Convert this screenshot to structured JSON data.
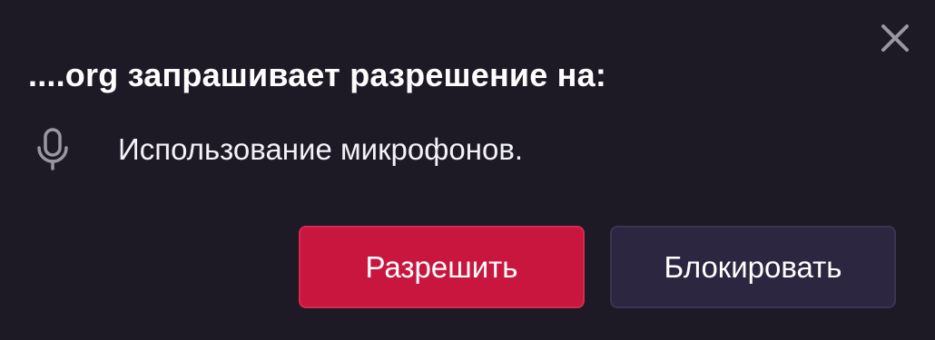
{
  "dialog": {
    "title": "....org запрашивает разрешение на:",
    "close_icon": "close-icon",
    "permission": {
      "icon": "microphone-icon",
      "text": "Использование микрофонов."
    },
    "buttons": {
      "allow_label": "Разрешить",
      "block_label": "Блокировать"
    }
  },
  "colors": {
    "background": "#1d1a26",
    "allow_button": "#c8163f",
    "block_button": "#2d2640",
    "text": "#ffffff",
    "icon": "#9a97a3"
  }
}
